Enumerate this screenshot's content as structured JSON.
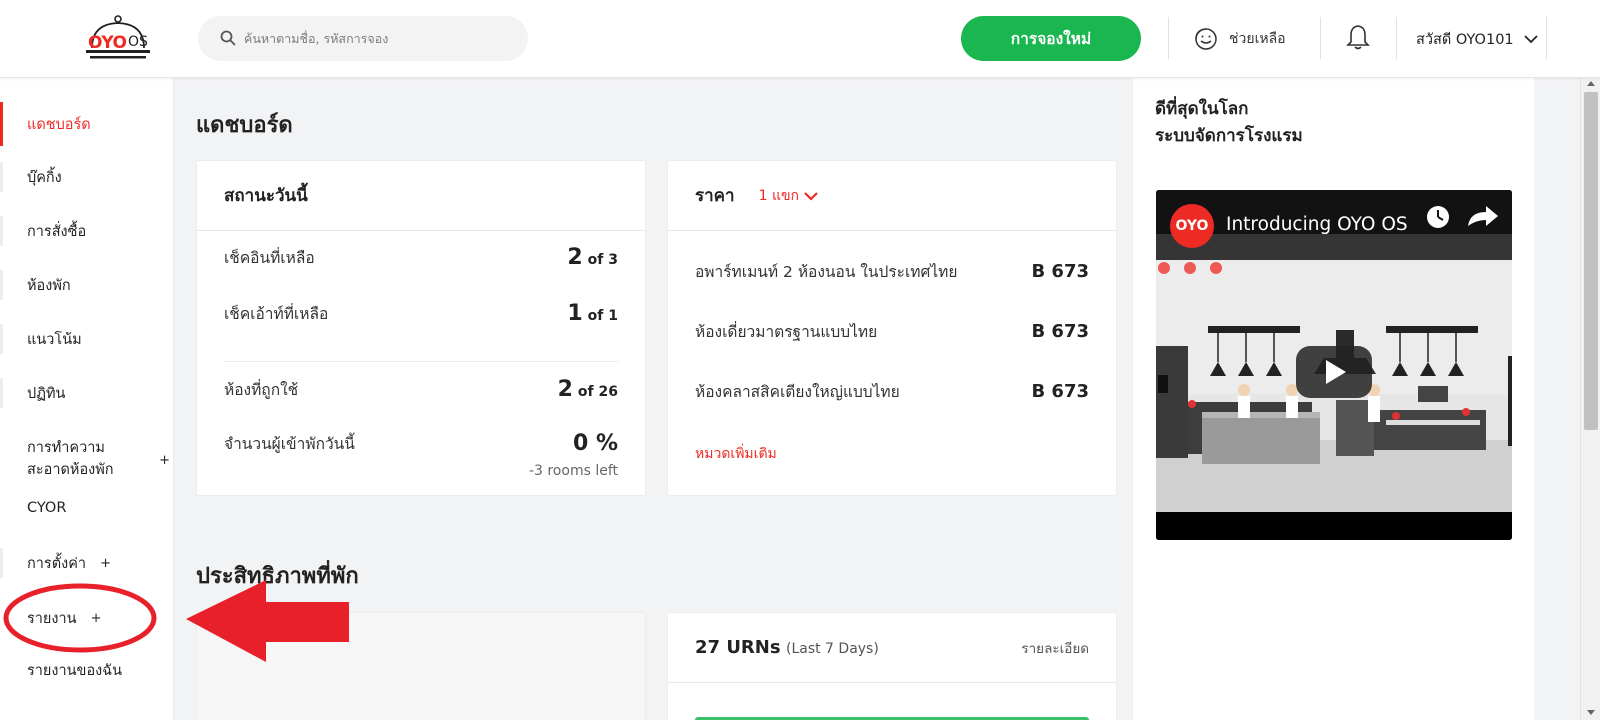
{
  "header": {
    "logo_brand": "OYO",
    "logo_os": "OS",
    "search_placeholder": "ค้นหาตามชื่อ, รหัสการจอง",
    "new_booking_label": "การจองใหม่",
    "help_label": "ช่วยเหลือ",
    "user_greeting": "สวัสดี OYO101"
  },
  "sidebar": {
    "items": [
      {
        "label": "แดชบอร์ด"
      },
      {
        "label": "บุ๊คกิ้ง"
      },
      {
        "label": "การสั่งซื้อ"
      },
      {
        "label": "ห้องพัก"
      },
      {
        "label": "แนวโน้ม"
      },
      {
        "label": "ปฏิทิน"
      },
      {
        "label": "การทำความสะอาดห้องพัก",
        "line1": "การทำความ",
        "line2": "สะอาดห้องพัก",
        "plus": "+"
      },
      {
        "label": "CYOR"
      },
      {
        "label": "การตั้งค่า",
        "plus": "+"
      },
      {
        "label": "รายงาน",
        "plus": "+"
      },
      {
        "label": "รายงานของฉัน"
      }
    ]
  },
  "main": {
    "title": "แดชบอร์ด",
    "status_card": {
      "title": "สถานะวันนี้",
      "rows": [
        {
          "label": "เช็คอินที่เหลือ",
          "value": "2",
          "suffix": "of 3"
        },
        {
          "label": "เช็คเอ้าท์ที่เหลือ",
          "value": "1",
          "suffix": "of 1"
        },
        {
          "label": "ห้องที่ถูกใช้",
          "value": "2",
          "suffix": "of 26"
        },
        {
          "label": "จำนวนผู้เข้าพักวันนี้",
          "value": "0 %",
          "sub": "-3 rooms left"
        }
      ]
    },
    "price_card": {
      "title": "ราคา",
      "dropdown_label": "1 แขก",
      "rows": [
        {
          "label": "อพาร์ทเมนท์ 2 ห้องนอน ในประเทศไทย",
          "price": "B 673"
        },
        {
          "label": "ห้องเดี่ยวมาตรฐานแบบไทย",
          "price": "B 673"
        },
        {
          "label": "ห้องคลาสสิคเตียงใหญ่แบบไทย",
          "price": "B 673"
        }
      ],
      "more_link": "หมวดเพิ่มเติม"
    },
    "performance_title": "ประสิทธิภาพที่พัก",
    "urn_card": {
      "count": "27 URNs",
      "period": "(Last 7 Days)",
      "detail_link": "รายละเอียด"
    }
  },
  "right_panel": {
    "promo_line1": "ดีที่สุดในโลก",
    "promo_line2": "ระบบจัดการโรงแรม",
    "video": {
      "channel_logo": "OYO",
      "title": "Introducing OYO OS"
    }
  },
  "colors": {
    "brand_red": "#ee2a24",
    "button_green": "#1ab64f",
    "annotation_red": "#e8202a"
  }
}
